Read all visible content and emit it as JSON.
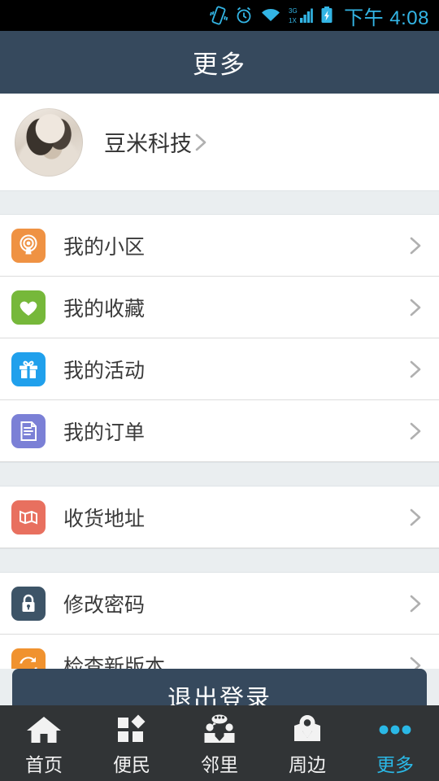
{
  "statusbar": {
    "icons": [
      "vibrate-icon",
      "alarm-icon",
      "wifi-icon",
      "signal-3g-icon",
      "battery-charging-icon"
    ],
    "time": "下午 4:08",
    "accent_color": "#33b5e5",
    "background_color": "#000000"
  },
  "header": {
    "title": "更多",
    "background_color": "#36495d"
  },
  "profile": {
    "name": "豆米科技",
    "avatar": "user-avatar",
    "chevron": "chevron-right-icon"
  },
  "sections": [
    {
      "items": [
        {
          "label": "我的小区",
          "icon": "broadcast-icon",
          "icon_color": "#ef9243",
          "chevron": "chevron-right-icon"
        },
        {
          "label": "我的收藏",
          "icon": "heart-icon",
          "icon_color": "#76b83a",
          "chevron": "chevron-right-icon"
        },
        {
          "label": "我的活动",
          "icon": "gift-icon",
          "icon_color": "#20a0ec",
          "chevron": "chevron-right-icon"
        },
        {
          "label": "我的订单",
          "icon": "order-document-icon",
          "icon_color": "#7b80d6",
          "chevron": "chevron-right-icon"
        }
      ]
    },
    {
      "items": [
        {
          "label": "收货地址",
          "icon": "map-address-icon",
          "icon_color": "#e8705f",
          "chevron": "chevron-right-icon"
        }
      ]
    },
    {
      "items": [
        {
          "label": "修改密码",
          "icon": "lock-icon",
          "icon_color": "#3d5467",
          "chevron": "chevron-right-icon"
        },
        {
          "label": "检查新版本",
          "icon": "refresh-icon",
          "icon_color": "#f0922f",
          "chevron": "chevron-right-icon"
        }
      ]
    }
  ],
  "logout": {
    "label": "退出登录",
    "background_color": "#36495d"
  },
  "navbar": {
    "background_color": "#313436",
    "active_color": "#2ab8e6",
    "items": [
      {
        "label": "首页",
        "icon": "home-icon",
        "active": false
      },
      {
        "label": "便民",
        "icon": "services-grid-icon",
        "active": false
      },
      {
        "label": "邻里",
        "icon": "neighbors-icon",
        "active": false
      },
      {
        "label": "周边",
        "icon": "map-pin-icon",
        "active": false
      },
      {
        "label": "更多",
        "icon": "more-dots-icon",
        "active": true
      }
    ]
  }
}
